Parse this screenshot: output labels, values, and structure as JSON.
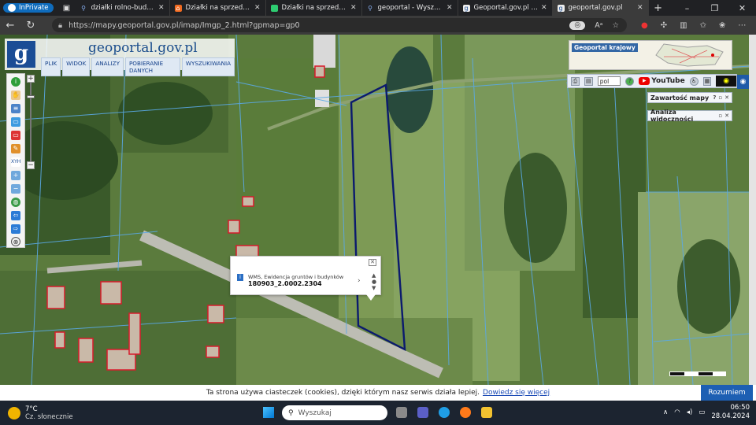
{
  "browser": {
    "inprivate": "InPrivate",
    "tabs": [
      {
        "title": "działki rolno-budowlane",
        "icon": "search-icon"
      },
      {
        "title": "Działki na sprzedaż Horyniec",
        "icon": "house-icon"
      },
      {
        "title": "Działki na sprzedaż: Horyniec",
        "icon": "listing-icon"
      },
      {
        "title": "geoportal - Wyszukaj",
        "icon": "search-icon"
      },
      {
        "title": "Geoportal.gov.pl – Geop",
        "icon": "geoportal-icon"
      },
      {
        "title": "geoportal.gov.pl",
        "icon": "geoportal-icon"
      }
    ],
    "url": "https://mapy.geoportal.gov.pl/imap/Imgp_2.html?gpmap=gp0"
  },
  "geoportal": {
    "brand_prefix": "geo",
    "brand_suffix": "portal.gov.pl",
    "logo": "g",
    "menu": [
      "PLIK",
      "WIDOK",
      "ANALIZY",
      "POBIERANIE DANYCH",
      "WYSZUKIWANIA"
    ],
    "overview_label": "Geoportal krajowy",
    "language": "pol",
    "youtube": "YouTube",
    "panels": [
      "Zawartość mapy",
      "Analiza widoczności"
    ]
  },
  "popup": {
    "layer": "WMS, Ewidencja gruntów i budynków",
    "plot_id": "180903_2.0002.2304"
  },
  "cookie": {
    "text": "Ta strona używa ciasteczek (cookies), dzięki którym nasz serwis działa lepiej.",
    "link": "Dowiedz się więcej",
    "button": "Rozumiem"
  },
  "taskbar": {
    "temp": "7°C",
    "weather": "Cz. słonecznie",
    "search_placeholder": "Wyszukaj",
    "time": "06:50",
    "date": "28.04.2024"
  },
  "colors": {
    "plot_outline": "#0b1a6e",
    "parcel_lines": "#5aa9e6",
    "buildings": "#d81b2a",
    "accent": "#1d5fb3"
  }
}
